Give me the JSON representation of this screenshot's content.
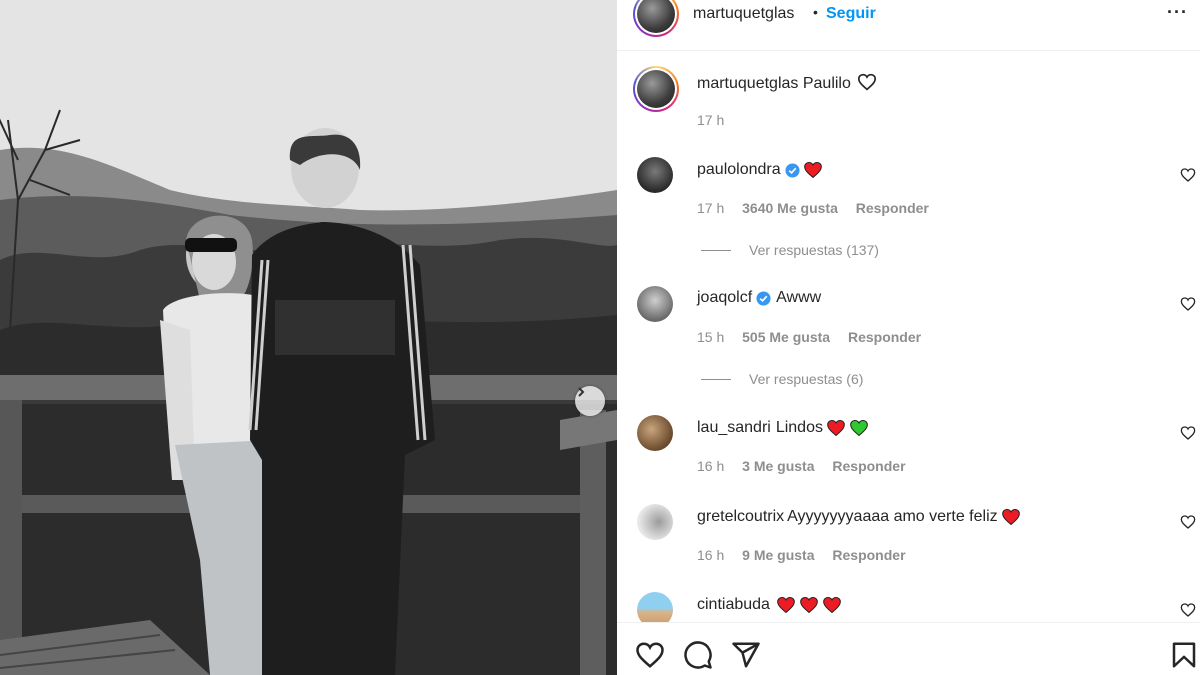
{
  "header": {
    "username": "martuquetglas",
    "separator": "•",
    "follow_label": "Seguir",
    "more_label": "···"
  },
  "caption": {
    "username": "martuquetglas",
    "text": "Paulilo",
    "time": "17 h"
  },
  "comments": [
    {
      "username": "paulolondra",
      "verified": true,
      "text": "",
      "emojis": [
        "red-heart"
      ],
      "time": "17 h",
      "likes": "3640 Me gusta",
      "reply_label": "Responder",
      "replies": "Ver respuestas (137)"
    },
    {
      "username": "joaqolcf",
      "verified": true,
      "text": "Awww",
      "emojis": [],
      "time": "15 h",
      "likes": "505 Me gusta",
      "reply_label": "Responder",
      "replies": "Ver respuestas (6)"
    },
    {
      "username": "lau_sandri",
      "verified": false,
      "text": "Lindos",
      "emojis": [
        "red-heart",
        "green-heart"
      ],
      "time": "16 h",
      "likes": "3 Me gusta",
      "reply_label": "Responder"
    },
    {
      "username": "gretelcoutrix",
      "verified": false,
      "text": "Ayyyyyyyaaaa amo verte feliz",
      "emojis": [
        "red-heart"
      ],
      "time": "16 h",
      "likes": "9 Me gusta",
      "reply_label": "Responder"
    },
    {
      "username": "cintiabuda",
      "verified": false,
      "text": "",
      "emojis": [
        "red-heart",
        "red-heart",
        "red-heart"
      ]
    }
  ],
  "actions": [
    "heart-icon",
    "comment-icon",
    "share-icon",
    "bookmark-icon"
  ],
  "colors": {
    "link": "#0095f6",
    "muted": "#8e8e8e",
    "text": "#262626",
    "heart_red": "#ed1c24",
    "heart_green": "#2ec92e",
    "verified": "#3897f0"
  }
}
